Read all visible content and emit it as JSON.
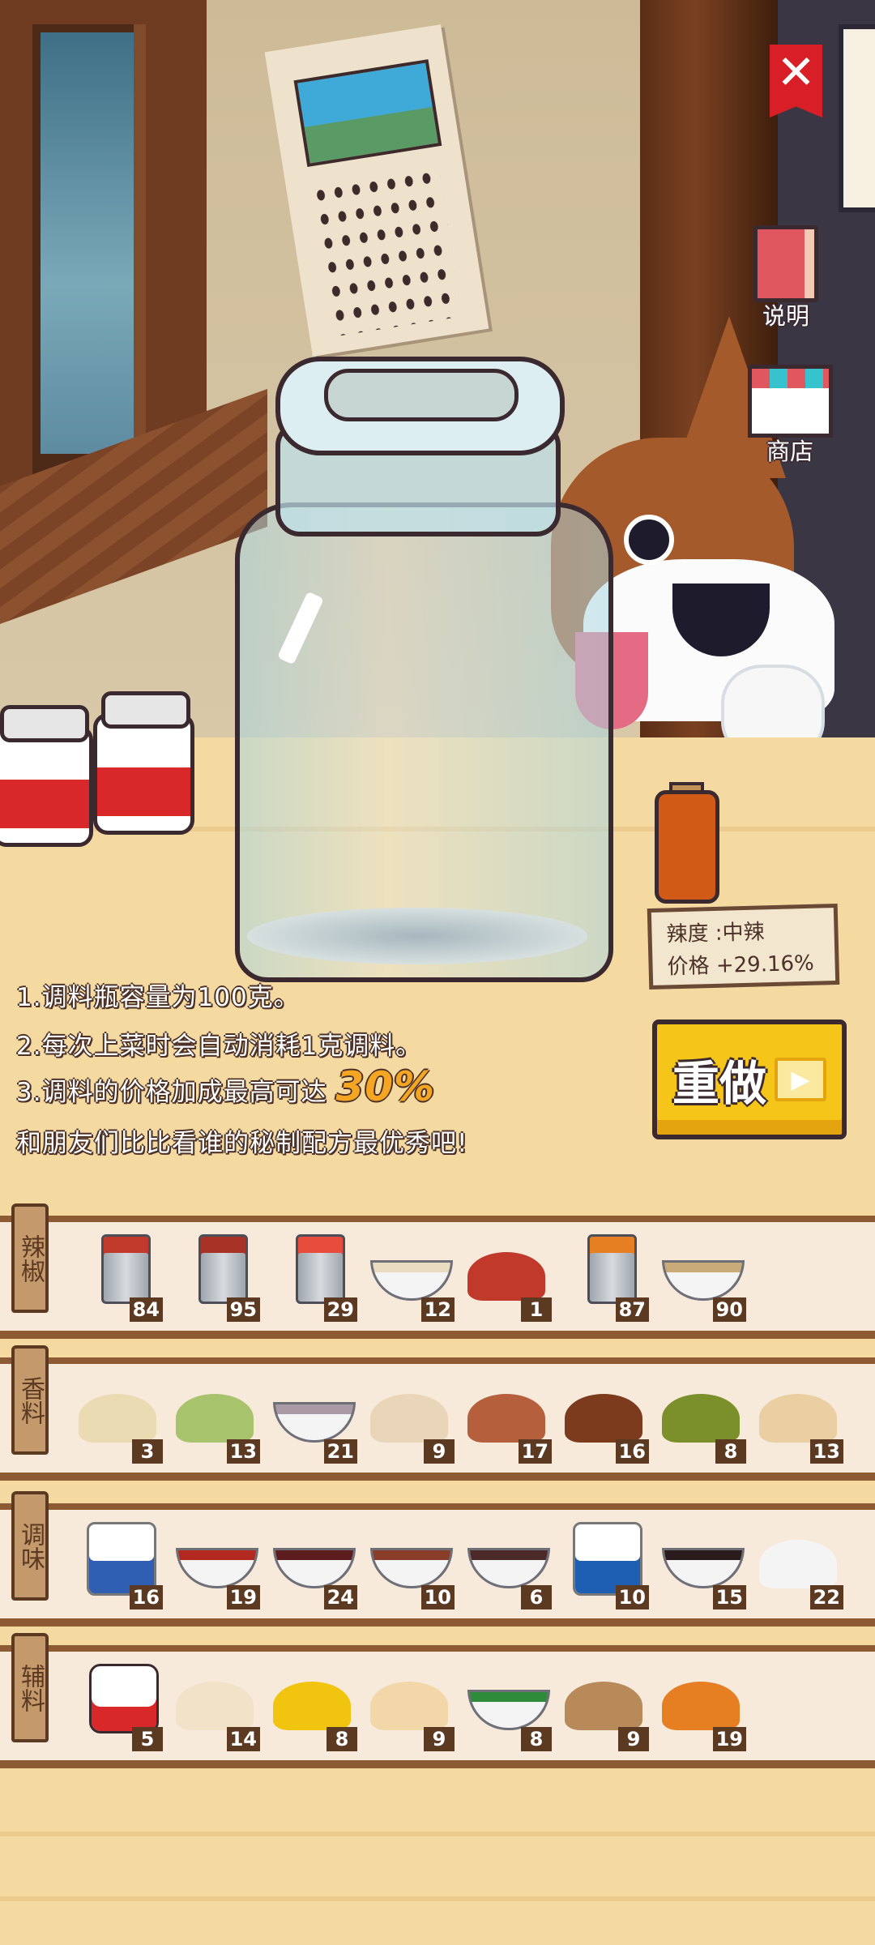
{
  "buttons": {
    "close": "✕",
    "guide_label": "说明",
    "shop_label": "商店",
    "redo_label": "重做",
    "redo_play": "▶"
  },
  "spice_tag": {
    "spiciness": "辣度 :中辣",
    "price": "价格 +29.16%"
  },
  "info": {
    "line1": "1.调料瓶容量为100克。",
    "line2": "2.每次上菜时会自动消耗1克调料。",
    "line3_prefix": "3.调料的价格加成最高可达 ",
    "line3_highlight": "30%",
    "line4": "和朋友们比比看谁的秘制配方最优秀吧!"
  },
  "shelves": [
    {
      "label": "辣椒",
      "items": [
        {
          "icon": "chili-powder-can-icon",
          "count": "84",
          "color": "#c0392b"
        },
        {
          "icon": "chili-powder-can-icon",
          "count": "95",
          "color": "#a93226"
        },
        {
          "icon": "chili-powder-can-icon",
          "count": "29",
          "color": "#e74c3c"
        },
        {
          "icon": "powder-bowl-icon",
          "count": "12",
          "color": "#e9dcc0"
        },
        {
          "icon": "dried-chili-pile-icon",
          "count": "1",
          "color": "#c0392b"
        },
        {
          "icon": "chili-powder-can-icon",
          "count": "87",
          "color": "#e67e22"
        },
        {
          "icon": "powder-bowl-icon",
          "count": "90",
          "color": "#c9ab7a"
        }
      ]
    },
    {
      "label": "香料",
      "items": [
        {
          "icon": "powder-pile-icon",
          "count": "3",
          "color": "#eadbb3"
        },
        {
          "icon": "cardamom-pod-icon",
          "count": "13",
          "color": "#a7c36b"
        },
        {
          "icon": "powder-bowl-icon",
          "count": "21",
          "color": "#a99aa6"
        },
        {
          "icon": "garlic-icon",
          "count": "9",
          "color": "#e9d6b8"
        },
        {
          "icon": "ginger-root-icon",
          "count": "17",
          "color": "#b65f3c"
        },
        {
          "icon": "star-anise-cinnamon-icon",
          "count": "16",
          "color": "#7b3b1c"
        },
        {
          "icon": "green-pepper-icon",
          "count": "8",
          "color": "#7b8f2a"
        },
        {
          "icon": "nutmeg-icon",
          "count": "13",
          "color": "#e9cfa1"
        }
      ]
    },
    {
      "label": "调味",
      "items": [
        {
          "icon": "salt-bag-icon",
          "count": "16",
          "color": "#2f5fb3"
        },
        {
          "icon": "sauce-bowl-icon",
          "count": "19",
          "color": "#b3281f"
        },
        {
          "icon": "sauce-bowl-icon",
          "count": "24",
          "color": "#5b1d1d"
        },
        {
          "icon": "sauce-bowl-icon",
          "count": "10",
          "color": "#8a3e2a"
        },
        {
          "icon": "sauce-bowl-icon",
          "count": "6",
          "color": "#4d2a2a"
        },
        {
          "icon": "msg-bag-icon",
          "count": "10",
          "color": "#1f5fb3"
        },
        {
          "icon": "sauce-bowl-icon",
          "count": "15",
          "color": "#2a1c1c"
        },
        {
          "icon": "rock-sugar-icon",
          "count": "22",
          "color": "#f4f4f4"
        }
      ]
    },
    {
      "label": "辅料",
      "items": [
        {
          "icon": "tomato-jar-icon",
          "count": "5",
          "color": "#d9282a"
        },
        {
          "icon": "peeled-garlic-icon",
          "count": "14",
          "color": "#f2e2c8"
        },
        {
          "icon": "lemon-slice-icon",
          "count": "8",
          "color": "#f1c40f"
        },
        {
          "icon": "ginger-slices-icon",
          "count": "9",
          "color": "#f2d8a8"
        },
        {
          "icon": "scallion-bowl-icon",
          "count": "8",
          "color": "#2e8b3a"
        },
        {
          "icon": "walnut-icon",
          "count": "9",
          "color": "#b88a5a"
        },
        {
          "icon": "peanut-carrot-icon",
          "count": "19",
          "color": "#e67e22"
        }
      ]
    }
  ]
}
